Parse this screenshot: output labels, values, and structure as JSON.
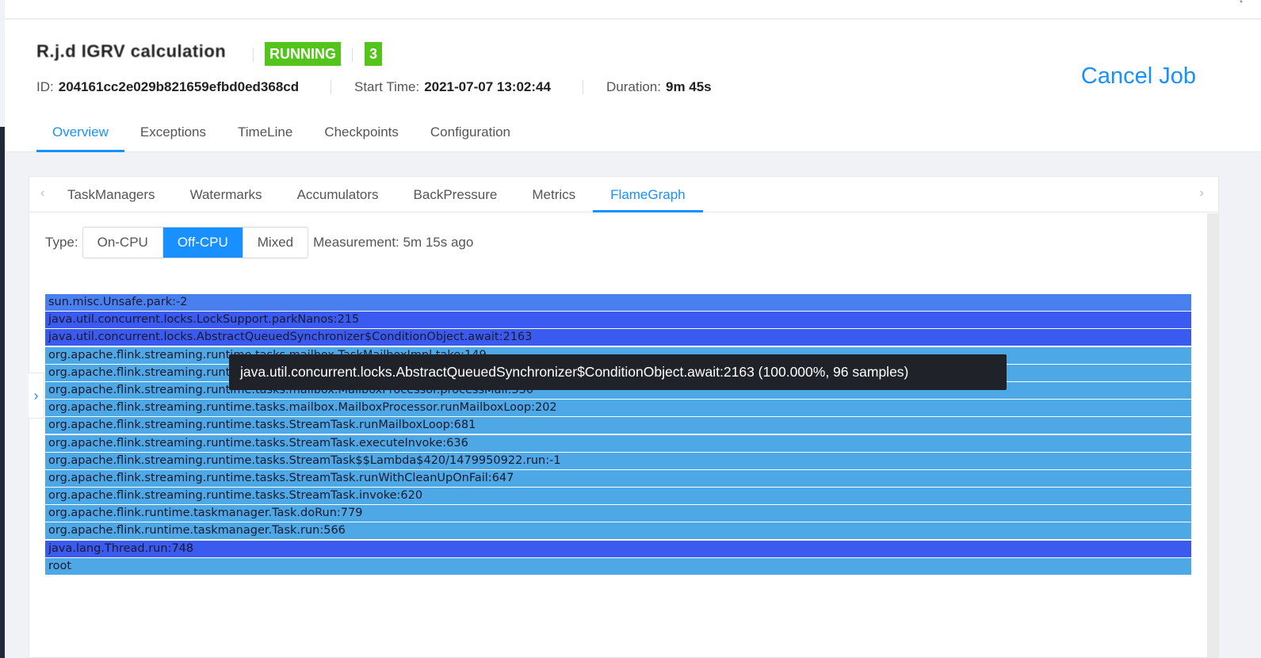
{
  "job": {
    "name": "R.j.d IGRV calculation",
    "status": "RUNNING",
    "parallelism": "3",
    "id_label": "ID:",
    "id": "204161cc2e029b821659efbd0ed368cd",
    "start_label": "Start Time:",
    "start": "2021-07-07 13:02:44",
    "duration_label": "Duration:",
    "duration": "9m 45s",
    "cancel_label": "Cancel Job"
  },
  "colors": {
    "accent": "#1890ff",
    "running": "#52c41a",
    "frame_dark": "#3a5af0",
    "frame_mid": "#4a7ff0",
    "frame_light": "#4fa8e6"
  },
  "tabs": [
    {
      "label": "Overview",
      "active": true
    },
    {
      "label": "Exceptions"
    },
    {
      "label": "TimeLine"
    },
    {
      "label": "Checkpoints"
    },
    {
      "label": "Configuration"
    }
  ],
  "subtabs": [
    {
      "label": "TaskManagers"
    },
    {
      "label": "Watermarks"
    },
    {
      "label": "Accumulators"
    },
    {
      "label": "BackPressure"
    },
    {
      "label": "Metrics"
    },
    {
      "label": "FlameGraph",
      "active": true
    }
  ],
  "type_control": {
    "label": "Type:",
    "options": [
      "On-CPU",
      "Off-CPU",
      "Mixed"
    ],
    "selected": "Off-CPU",
    "measurement": "Measurement: 5m 15s ago"
  },
  "flamegraph": {
    "frames": [
      {
        "label": "sun.misc.Unsafe.park:-2",
        "shade": "mid"
      },
      {
        "label": "java.util.concurrent.locks.LockSupport.parkNanos:215",
        "shade": "dark"
      },
      {
        "label": "java.util.concurrent.locks.AbstractQueuedSynchronizer$ConditionObject.await:2163",
        "shade": "dark"
      },
      {
        "label": "org.apache.flink.streaming.runtime.tasks.mailbox.TaskMailboxImpl.take:149",
        "shade": "light"
      },
      {
        "label": "org.apache.flink.streaming.runtime.tasks.mailbox.MailboxProcessor.processMailsWhenDefaultActionUnavailable:335",
        "shade": "light"
      },
      {
        "label": "org.apache.flink.streaming.runtime.tasks.mailbox.MailboxProcessor.processMail:330",
        "shade": "light"
      },
      {
        "label": "org.apache.flink.streaming.runtime.tasks.mailbox.MailboxProcessor.runMailboxLoop:202",
        "shade": "light"
      },
      {
        "label": "org.apache.flink.streaming.runtime.tasks.StreamTask.runMailboxLoop:681",
        "shade": "light"
      },
      {
        "label": "org.apache.flink.streaming.runtime.tasks.StreamTask.executeInvoke:636",
        "shade": "light"
      },
      {
        "label": "org.apache.flink.streaming.runtime.tasks.StreamTask$$Lambda$420/1479950922.run:-1",
        "shade": "light"
      },
      {
        "label": "org.apache.flink.streaming.runtime.tasks.StreamTask.runWithCleanUpOnFail:647",
        "shade": "light"
      },
      {
        "label": "org.apache.flink.streaming.runtime.tasks.StreamTask.invoke:620",
        "shade": "light"
      },
      {
        "label": "org.apache.flink.runtime.taskmanager.Task.doRun:779",
        "shade": "light"
      },
      {
        "label": "org.apache.flink.runtime.taskmanager.Task.run:566",
        "shade": "light"
      },
      {
        "label": "java.lang.Thread.run:748",
        "shade": "dark"
      },
      {
        "label": "root",
        "shade": "light"
      }
    ],
    "tooltip": "java.util.concurrent.locks.AbstractQueuedSynchronizer$ConditionObject.await:2163 (100.000%, 96 samples)"
  },
  "icons": {
    "left": "chevron-left-icon",
    "right": "chevron-right-icon",
    "side": "chevron-right-icon"
  }
}
